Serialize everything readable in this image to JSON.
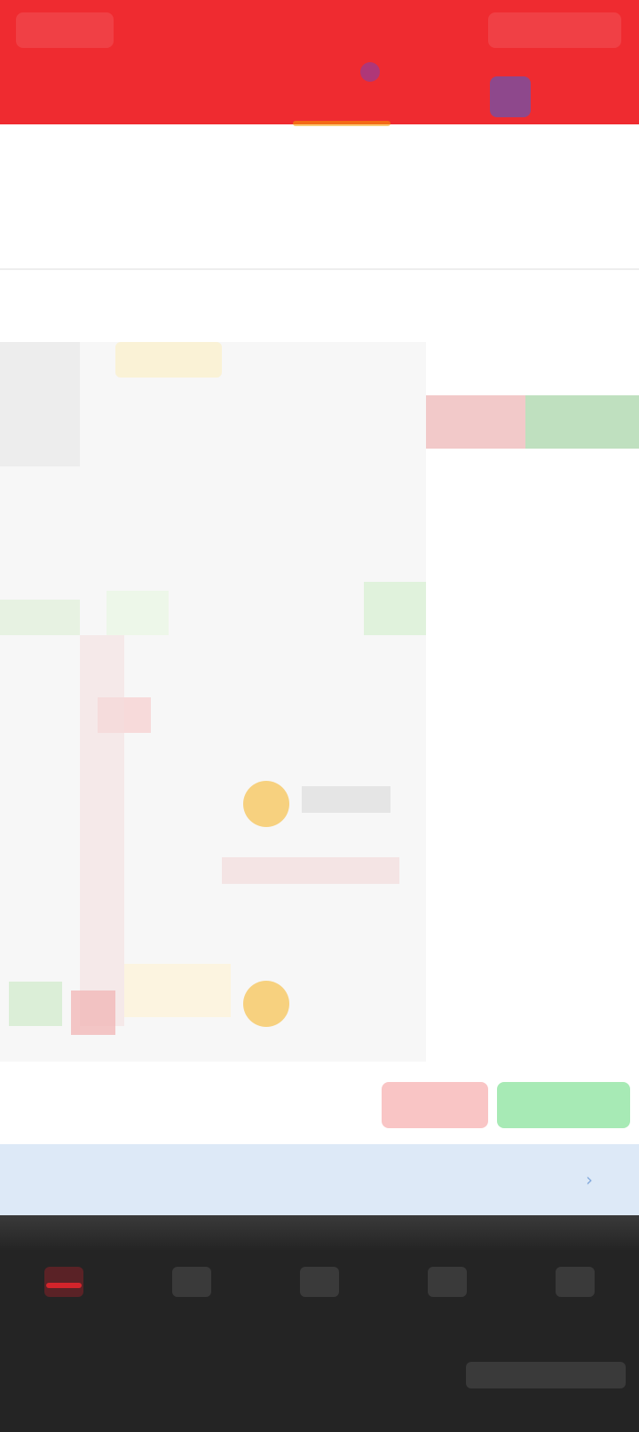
{
  "header": {
    "left_label": "",
    "right_label": "",
    "buttons": [
      "",
      "",
      "",
      ""
    ],
    "title": "",
    "subtitle": ""
  },
  "quote": {
    "price": "",
    "change": "",
    "stats": [
      "",
      "",
      "",
      "",
      "",
      ""
    ]
  },
  "tabs": [
    "",
    "",
    "",
    "",
    "",
    "",
    ""
  ],
  "order_book": {
    "sell_label": "",
    "buy_label": "",
    "header": "",
    "rows": [
      {
        "time": "",
        "price": "",
        "volume": ""
      },
      {
        "time": "",
        "price": "",
        "volume": ""
      },
      {
        "time": "",
        "price": "",
        "volume": ""
      },
      {
        "time": "",
        "price": "",
        "volume": ""
      },
      {
        "time": "",
        "price": "",
        "volume": ""
      },
      {
        "time": "",
        "price": "",
        "volume": ""
      },
      {
        "time": "",
        "price": "",
        "volume": ""
      },
      {
        "time": "",
        "price": "",
        "volume": ""
      },
      {
        "time": "",
        "price": "",
        "volume": ""
      },
      {
        "time": "",
        "price": "",
        "volume": ""
      },
      {
        "time": "",
        "price": "",
        "volume": ""
      },
      {
        "time": "",
        "price": "",
        "volume": ""
      }
    ]
  },
  "actions": {
    "item1": "",
    "item2": "",
    "item3": "",
    "sell": "",
    "buy": ""
  },
  "promo": {
    "text": "",
    "arrow": "›"
  },
  "nav": [
    "",
    "",
    "",
    "",
    ""
  ],
  "colors": {
    "header_red": "#ef2b30",
    "up_red": "#e8353c",
    "down_green": "#18a33b",
    "nav_bg": "#242424",
    "promo_bg": "#dde9f7"
  }
}
